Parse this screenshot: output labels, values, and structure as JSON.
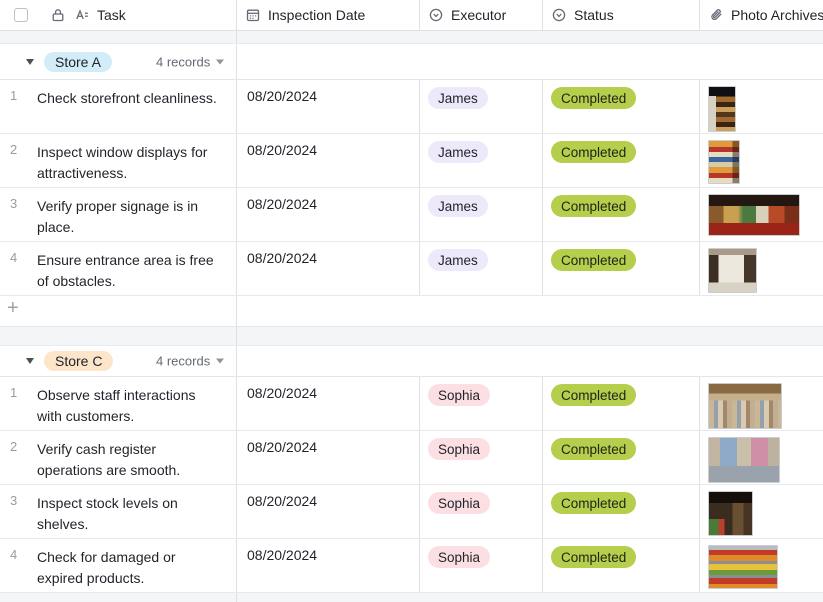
{
  "columns": [
    {
      "label": "Task",
      "field_icons": [
        "lock-icon",
        "text-field-icon"
      ]
    },
    {
      "label": "Inspection Date",
      "field_icon": "calendar-icon"
    },
    {
      "label": "Executor",
      "field_icon": "single-select-icon"
    },
    {
      "label": "Status",
      "field_icon": "single-select-icon"
    },
    {
      "label": "Photo Archives",
      "field_icon": "paperclip-icon"
    }
  ],
  "add_record_icon": "+",
  "groups": [
    {
      "name": "Store A",
      "records_label": "4 records",
      "pill_color": "#D3EDF8",
      "rows": [
        {
          "num": "1",
          "task": "Check storefront cleanliness.",
          "date": "08/20/2024",
          "executor": "James",
          "status": "Completed",
          "photo_desc": "store shelf aisle photo"
        },
        {
          "num": "2",
          "task": "Inspect window displays for attractiveness.",
          "date": "08/20/2024",
          "executor": "James",
          "status": "Completed",
          "photo_desc": "window display shelves photo"
        },
        {
          "num": "3",
          "task": "Verify proper signage is in place.",
          "date": "08/20/2024",
          "executor": "James",
          "status": "Completed",
          "photo_desc": "store interior signage photo"
        },
        {
          "num": "4",
          "task": "Ensure entrance area is free of obstacles.",
          "date": "08/20/2024",
          "executor": "James",
          "status": "Completed",
          "photo_desc": "store entrance doors photo"
        }
      ]
    },
    {
      "name": "Store C",
      "records_label": "4 records",
      "pill_color": "#FCE5C9",
      "rows": [
        {
          "num": "1",
          "task": "Observe staff interactions with customers.",
          "date": "08/20/2024",
          "executor": "Sophia",
          "status": "Completed",
          "photo_desc": "busy market with customers photo"
        },
        {
          "num": "2",
          "task": "Verify cash register operations are smooth.",
          "date": "08/20/2024",
          "executor": "Sophia",
          "status": "Completed",
          "photo_desc": "cashier serving customer photo"
        },
        {
          "num": "3",
          "task": "Inspect stock levels on shelves.",
          "date": "08/20/2024",
          "executor": "Sophia",
          "status": "Completed",
          "photo_desc": "stocked shelves dark store photo"
        },
        {
          "num": "4",
          "task": "Check for damaged or expired products.",
          "date": "08/20/2024",
          "executor": "Sophia",
          "status": "Completed",
          "photo_desc": "produce shelves photo"
        }
      ]
    }
  ],
  "colors": {
    "executor_james_pill": "#EDE8FA",
    "executor_sophia_pill": "#FCDFE3",
    "status_completed_pill": "#B5CE4B",
    "group_store_a_pill": "#D3EDF8",
    "group_store_c_pill": "#FCE5C9",
    "grid_border": "#DEE0E3",
    "gap_band": "#F4F5F6"
  }
}
